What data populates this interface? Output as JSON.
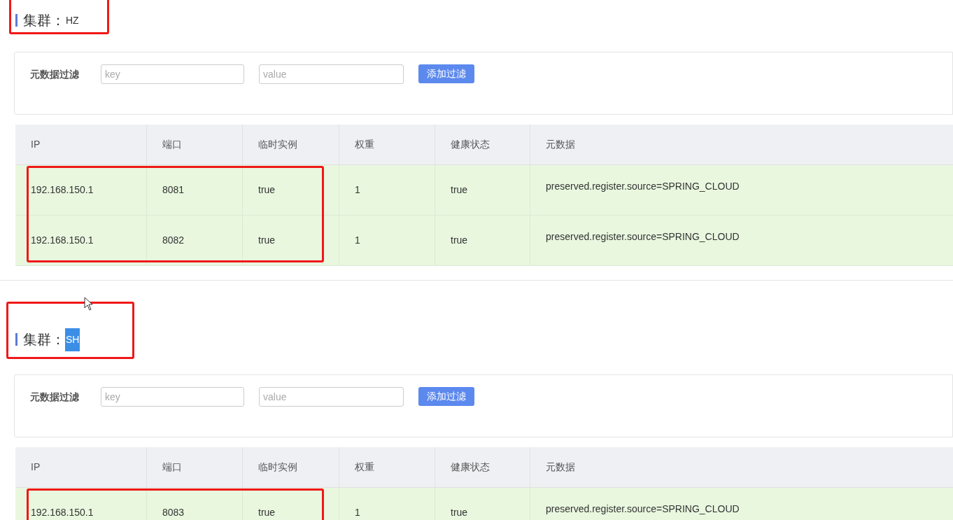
{
  "clusters": [
    {
      "label": "集群：",
      "name": "HZ",
      "name_highlighted": false,
      "heading_annotated": true,
      "filter": {
        "label": "元数据过滤",
        "key_placeholder": "key",
        "value_placeholder": "value",
        "button": "添加过滤"
      },
      "table": {
        "columns": [
          "IP",
          "端口",
          "临时实例",
          "权重",
          "健康状态",
          "元数据"
        ],
        "rows": [
          {
            "cells": [
              "192.168.150.1",
              "8081",
              "true",
              "1",
              "true",
              "preserved.register.source=SPRING_CLOUD"
            ],
            "annotated": true
          },
          {
            "cells": [
              "192.168.150.1",
              "8082",
              "true",
              "1",
              "true",
              "preserved.register.source=SPRING_CLOUD"
            ],
            "annotated": true
          }
        ]
      }
    },
    {
      "label": "集群：",
      "name": "SH",
      "name_highlighted": true,
      "heading_annotated": true,
      "filter": {
        "label": "元数据过滤",
        "key_placeholder": "key",
        "value_placeholder": "value",
        "button": "添加过滤"
      },
      "table": {
        "columns": [
          "IP",
          "端口",
          "临时实例",
          "权重",
          "健康状态",
          "元数据"
        ],
        "rows": [
          {
            "cells": [
              "192.168.150.1",
              "8083",
              "true",
              "1",
              "true",
              "preserved.register.source=SPRING_CLOUD"
            ],
            "annotated": true
          }
        ]
      }
    }
  ],
  "pointer_visible": true
}
